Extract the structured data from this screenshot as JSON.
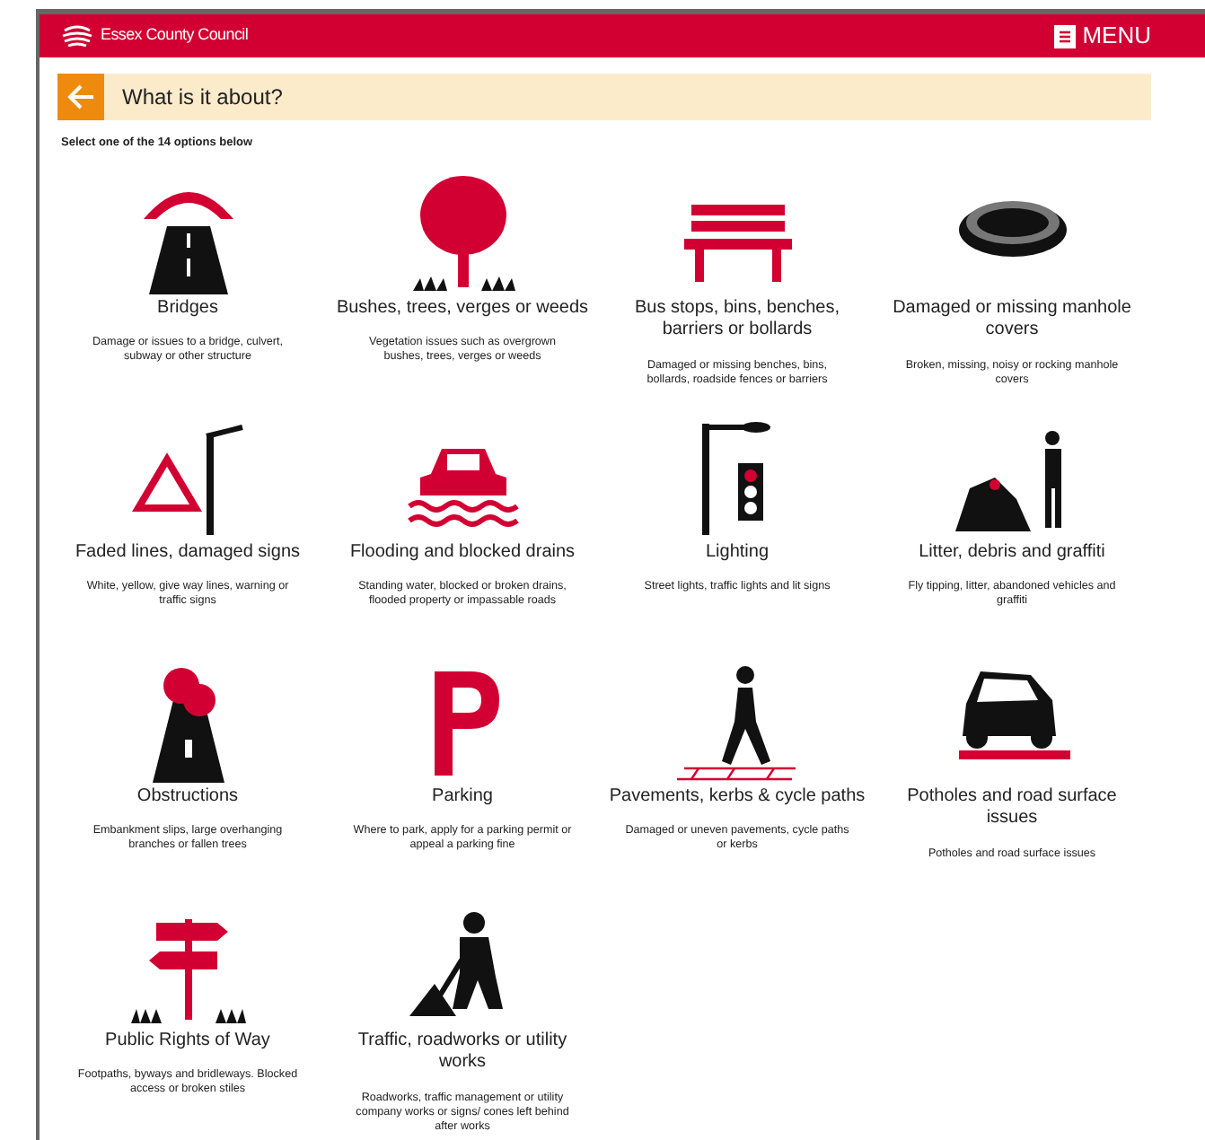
{
  "header": {
    "brand": "Essex County Council",
    "menu_label": "MENU"
  },
  "question": {
    "title": "What is it about?"
  },
  "instruction": "Select one of the 14 options below",
  "options": [
    {
      "title": "Bridges",
      "description": "Damage or issues to a bridge, culvert, subway or other structure"
    },
    {
      "title": "Bushes, trees, verges or weeds",
      "description": "Vegetation issues such as overgrown bushes, trees, verges or weeds"
    },
    {
      "title": "Bus stops, bins, benches, barriers or bollards",
      "description": "Damaged or missing benches, bins, bollards, roadside fences or barriers"
    },
    {
      "title": "Damaged or missing manhole covers",
      "description": "Broken, missing, noisy or rocking manhole covers"
    },
    {
      "title": "Faded lines, damaged signs",
      "description": "White, yellow, give way lines, warning or traffic signs"
    },
    {
      "title": "Flooding and blocked drains",
      "description": "Standing water, blocked or broken drains, flooded property or impassable roads"
    },
    {
      "title": "Lighting",
      "description": "Street lights, traffic lights and lit signs"
    },
    {
      "title": "Litter, debris and graffiti",
      "description": "Fly tipping, litter, abandoned vehicles and graffiti"
    },
    {
      "title": "Obstructions",
      "description": "Embankment slips, large overhanging branches or fallen trees"
    },
    {
      "title": "Parking",
      "description": "Where to park, apply for a parking permit or appeal a parking  fine"
    },
    {
      "title": "Pavements, kerbs & cycle paths",
      "description": "Damaged or uneven pavements, cycle paths or kerbs"
    },
    {
      "title": "Potholes and road surface issues",
      "description": "Potholes and road surface issues"
    },
    {
      "title": "Public Rights of Way",
      "description": "Footpaths, byways and bridleways. Blocked access or broken stiles"
    },
    {
      "title": "Traffic, roadworks or utility works",
      "description": "Roadworks, traffic management or utility company works or signs/ cones left behind after works"
    }
  ]
}
